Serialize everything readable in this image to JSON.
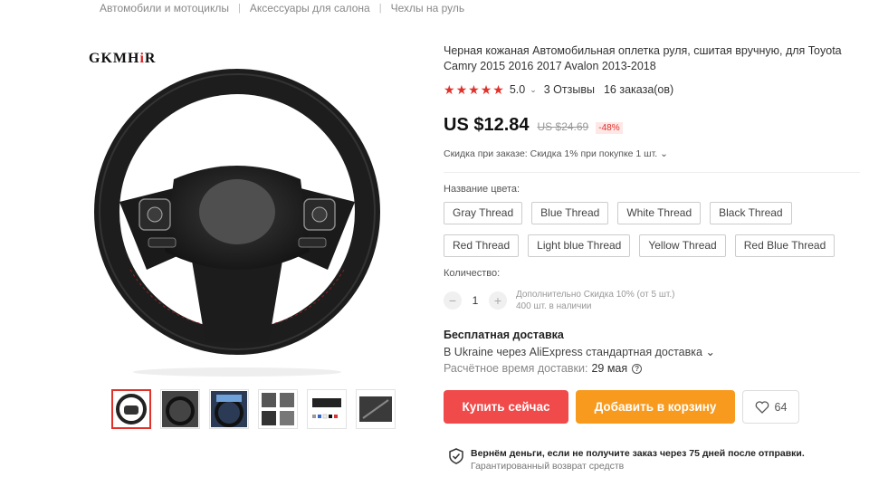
{
  "breadcrumb": [
    "Автомобили и мотоциклы",
    "Аксессуары для салона",
    "Чехлы на руль"
  ],
  "brand": {
    "text_a": "GKMH",
    "text_i": "i",
    "text_b": "R"
  },
  "product": {
    "title": "Черная кожаная Автомобильная оплетка руля, сшитая вручную, для Toyota Camry 2015 2016 2017 Avalon 2013-2018",
    "rating": "5.0",
    "reviews": "3 Отзывы",
    "orders": "16 заказа(ов)",
    "price": "US $12.84",
    "old_price": "US $24.69",
    "discount": "-48%",
    "bulk_discount": "Скидка при заказе: Скидка 1% при покупке 1 шт."
  },
  "colors": {
    "label": "Название цвета:",
    "options": [
      "Gray Thread",
      "Blue Thread",
      "White Thread",
      "Black Thread",
      "Red Thread",
      "Light blue Thread",
      "Yellow Thread",
      "Red Blue Thread"
    ]
  },
  "quantity": {
    "label": "Количество:",
    "value": "1",
    "minus": "−",
    "plus": "+",
    "extra_discount": "Дополнительно Скидка 10% (от 5 шт.)",
    "stock": "400 шт. в наличии"
  },
  "shipping": {
    "title": "Бесплатная доставка",
    "method": "В Ukraine через AliExpress стандартная доставка",
    "time_label": "Расчётное время доставки:",
    "date": "29 мая"
  },
  "actions": {
    "buy": "Купить сейчас",
    "cart": "Добавить в корзину",
    "wishlist_count": "64"
  },
  "guarantee": {
    "line1": "Вернём деньги, если не получите заказ через 75 дней после отправки.",
    "line2": "Гарантированный возврат средств"
  },
  "colors_theme": {
    "accent": "#e0322a",
    "buy": "#f04a4a",
    "cart": "#f79a1e"
  }
}
